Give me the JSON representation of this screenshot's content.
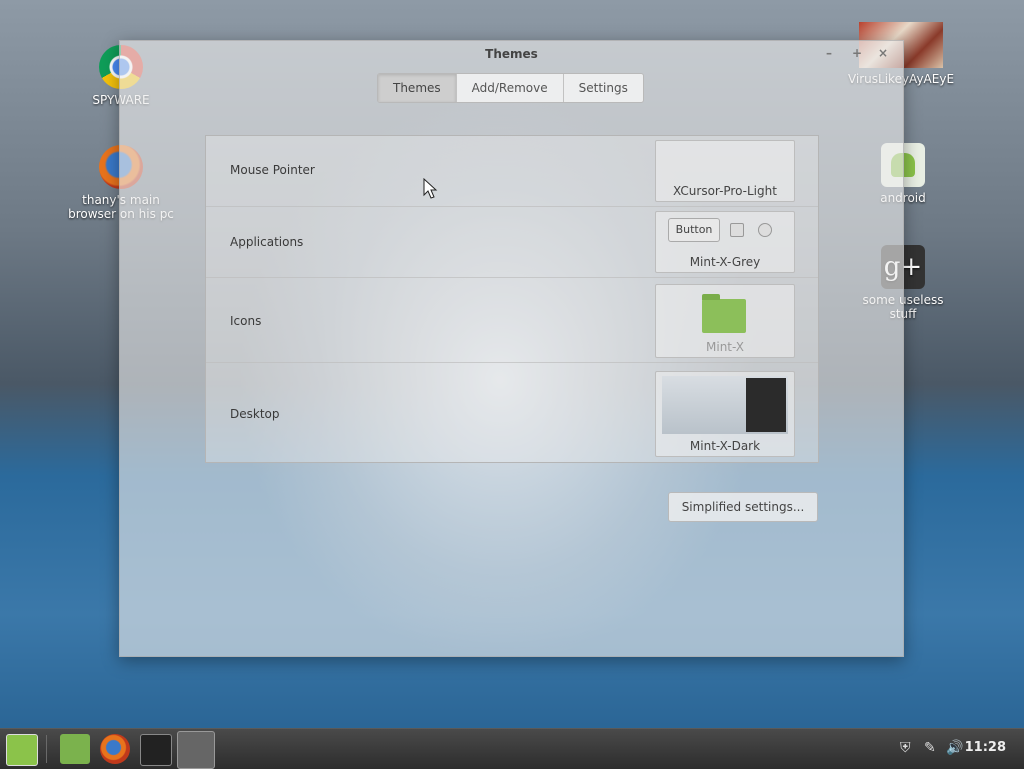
{
  "desktop": {
    "icons": [
      {
        "label": "SPYWARE",
        "icon": "chrome-icon"
      },
      {
        "label": "thany's main browser on his pc",
        "icon": "firefox-icon"
      },
      {
        "label": "VirusLikeyAyAEyE",
        "icon": "photo-icon"
      },
      {
        "label": "android",
        "icon": "android-icon"
      },
      {
        "label": "some useless stuff",
        "icon": "google-plus-icon"
      }
    ]
  },
  "window": {
    "title": "Themes",
    "controls": {
      "minimize": "–",
      "maximize": "+",
      "close": "×"
    },
    "tabs": [
      {
        "label": "Themes",
        "active": true
      },
      {
        "label": "Add/Remove",
        "active": false
      },
      {
        "label": "Settings",
        "active": false
      }
    ],
    "rows": [
      {
        "label": "Mouse Pointer",
        "value": "XCursor-Pro-Light"
      },
      {
        "label": "Applications",
        "value": "Mint-X-Grey",
        "preview_button": "Button"
      },
      {
        "label": "Icons",
        "value": "Mint-X"
      },
      {
        "label": "Desktop",
        "value": "Mint-X-Dark"
      }
    ],
    "simplified_button": "Simplified settings..."
  },
  "taskbar": {
    "items": [
      "mint-menu-icon",
      "files-icon",
      "firefox-icon",
      "terminal-icon",
      "themes-settings-icon"
    ],
    "tray": [
      "shield-icon",
      "network-icon",
      "volume-icon"
    ],
    "clock": "11:28"
  }
}
